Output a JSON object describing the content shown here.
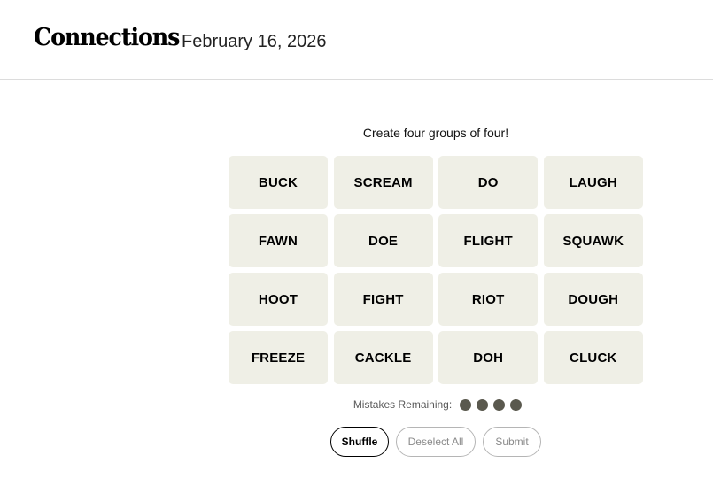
{
  "header": {
    "title": "Connections",
    "date": "February 16, 2026"
  },
  "game": {
    "instructions": "Create four groups of four!",
    "words": [
      "BUCK",
      "SCREAM",
      "DO",
      "LAUGH",
      "FAWN",
      "DOE",
      "FLIGHT",
      "SQUAWK",
      "HOOT",
      "FIGHT",
      "RIOT",
      "DOUGH",
      "FREEZE",
      "CACKLE",
      "DOH",
      "CLUCK"
    ],
    "mistakes_label": "Mistakes Remaining:",
    "mistakes_remaining": 4,
    "tile_color": "#efefe6",
    "dot_color": "#5a594e"
  },
  "controls": {
    "shuffle": "Shuffle",
    "deselect": "Deselect All",
    "submit": "Submit"
  }
}
